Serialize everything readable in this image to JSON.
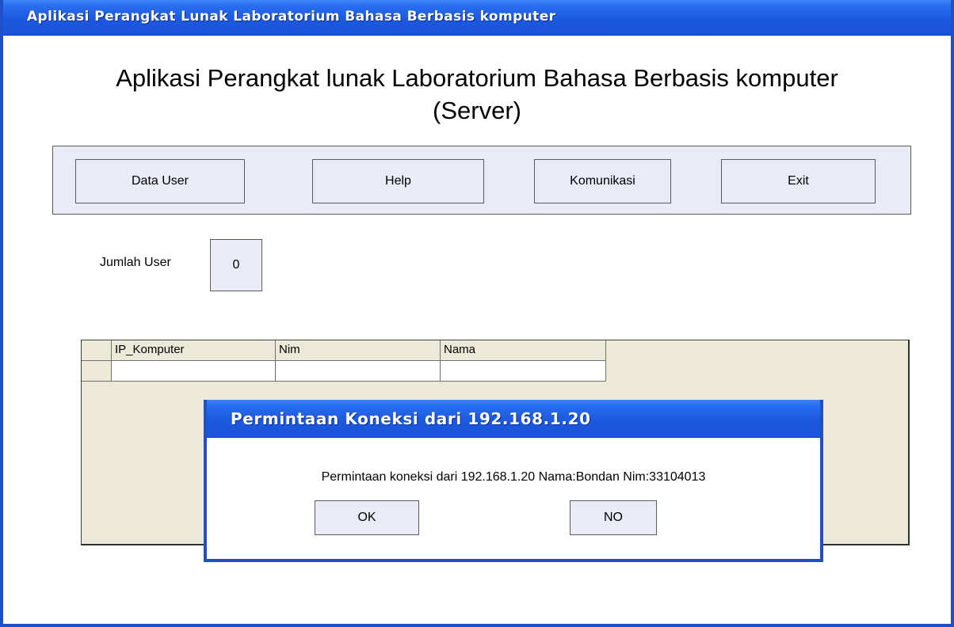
{
  "window": {
    "title": "Aplikasi Perangkat Lunak Laboratorium Bahasa Berbasis komputer"
  },
  "heading": {
    "line1": "Aplikasi Perangkat lunak Laboratorium Bahasa Berbasis komputer",
    "line2": "(Server)"
  },
  "toolbar": {
    "data_user": "Data User",
    "help": "Help",
    "komunikasi": "Komunikasi",
    "exit": "Exit"
  },
  "jumlah_user": {
    "label": "Jumlah User",
    "value": "0"
  },
  "grid": {
    "columns": [
      "IP_Komputer",
      "Nim",
      "Nama"
    ],
    "rows": [
      [
        "",
        "",
        ""
      ]
    ]
  },
  "dialog": {
    "title": "Permintaan Koneksi dari 192.168.1.20",
    "message": "Permintaan koneksi dari 192.168.1.20 Nama:Bondan Nim:33104013",
    "ok_label": "OK",
    "no_label": "NO"
  },
  "colors": {
    "titlebar": "#1c59de",
    "panel": "#e9ecf6",
    "grid_background": "#ece9d8"
  }
}
